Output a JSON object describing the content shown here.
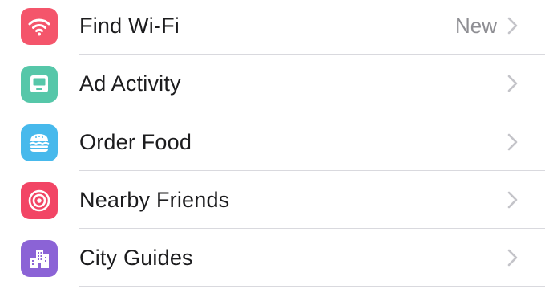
{
  "menu": {
    "items": [
      {
        "label": "Find Wi-Fi",
        "badge": "New",
        "icon": "wifi-icon",
        "color": "#f4556b"
      },
      {
        "label": "Ad Activity",
        "badge": "",
        "icon": "monitor-icon",
        "color": "#56c7a9"
      },
      {
        "label": "Order Food",
        "badge": "",
        "icon": "burger-icon",
        "color": "#47b9ec"
      },
      {
        "label": "Nearby Friends",
        "badge": "",
        "icon": "target-icon",
        "color": "#f24565"
      },
      {
        "label": "City Guides",
        "badge": "",
        "icon": "city-icon",
        "color": "#8b63d6"
      }
    ]
  }
}
